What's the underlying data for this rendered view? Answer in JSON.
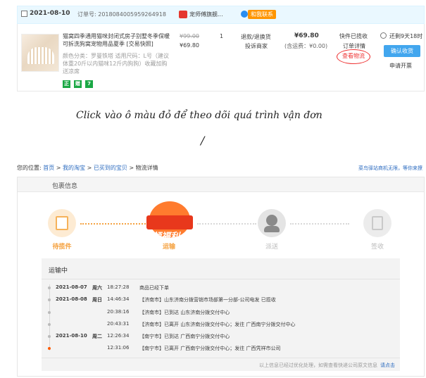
{
  "order": {
    "date": "2021-08-10",
    "order_no_label": "订单号: 2018084005959264918",
    "shop_name": "宠师傅旗舰...",
    "chat_label": "和我联系",
    "title": "猫窝四季通用猫咪封闭式房子别墅冬季保暖可拆洗狗窝宠物用品夏季 [交易快照]",
    "props": "颜色分类：罗曼铁塔 适用尺码：L号（建议体重20斤以内猫咪12斤内狗狗）收藏加购送凉席",
    "tags": [
      "正",
      "赠",
      "7"
    ],
    "orig_price": "¥99.00",
    "price": "¥69.80",
    "qty": "1",
    "refund_links": [
      "退款/退换货",
      "投诉商家"
    ],
    "total": "¥69.80",
    "total_note": "(含运费：¥0.00)",
    "status_lines": [
      "快件已揽收",
      "订单详情",
      "查看物流"
    ],
    "countdown": "还剩9天18时",
    "confirm_label": "确认收货",
    "invoice_label": "申请开票"
  },
  "caption": {
    "text": "Click vào ô màu đỏ để theo dõi quá trình vận đơn",
    "slash": "/"
  },
  "logistics": {
    "breadcrumb_prefix": "您的位置:",
    "breadcrumb": [
      "首页",
      "我的淘宝",
      "已买到的宝贝",
      "物流详情"
    ],
    "breadcrumb_sep": ">",
    "top_right": "菜鸟驿站商机无限，等你来撩",
    "panel_title": "包裹信息",
    "steps": [
      "待揽件",
      "运输",
      "派送",
      "签收"
    ],
    "promo": "领福利",
    "status_title": "运输中",
    "events": [
      {
        "date": "2021-08-07",
        "weekday": "周六",
        "time": "18:27:28",
        "text": "商品已经下单"
      },
      {
        "date": "2021-08-08",
        "weekday": "周日",
        "time": "14:46:34",
        "text": "【济南市】山东济南分拨营销市场部第一分部-公司电发 已揽收"
      },
      {
        "date": "",
        "weekday": "",
        "time": "20:38:16",
        "text": "【济南市】已到达 山东济南分拨交付中心"
      },
      {
        "date": "",
        "weekday": "",
        "time": "20:43:31",
        "text": "【济南市】已离开 山东济南分拨交付中心；发往 广西南宁分拨交付中心"
      },
      {
        "date": "2021-08-10",
        "weekday": "周二",
        "time": "12:26:34",
        "text": "【南宁市】已到达 广西南宁分拨交付中心"
      },
      {
        "date": "",
        "weekday": "",
        "time": "12:31:06",
        "text": "【南宁市】已离开 广西南宁分拨交付中心；发往 广西凭祥市公司"
      }
    ],
    "footer_note": "以上信息已经过优化处理，如需查看快递公司原文信息",
    "footer_link": "请点击"
  }
}
